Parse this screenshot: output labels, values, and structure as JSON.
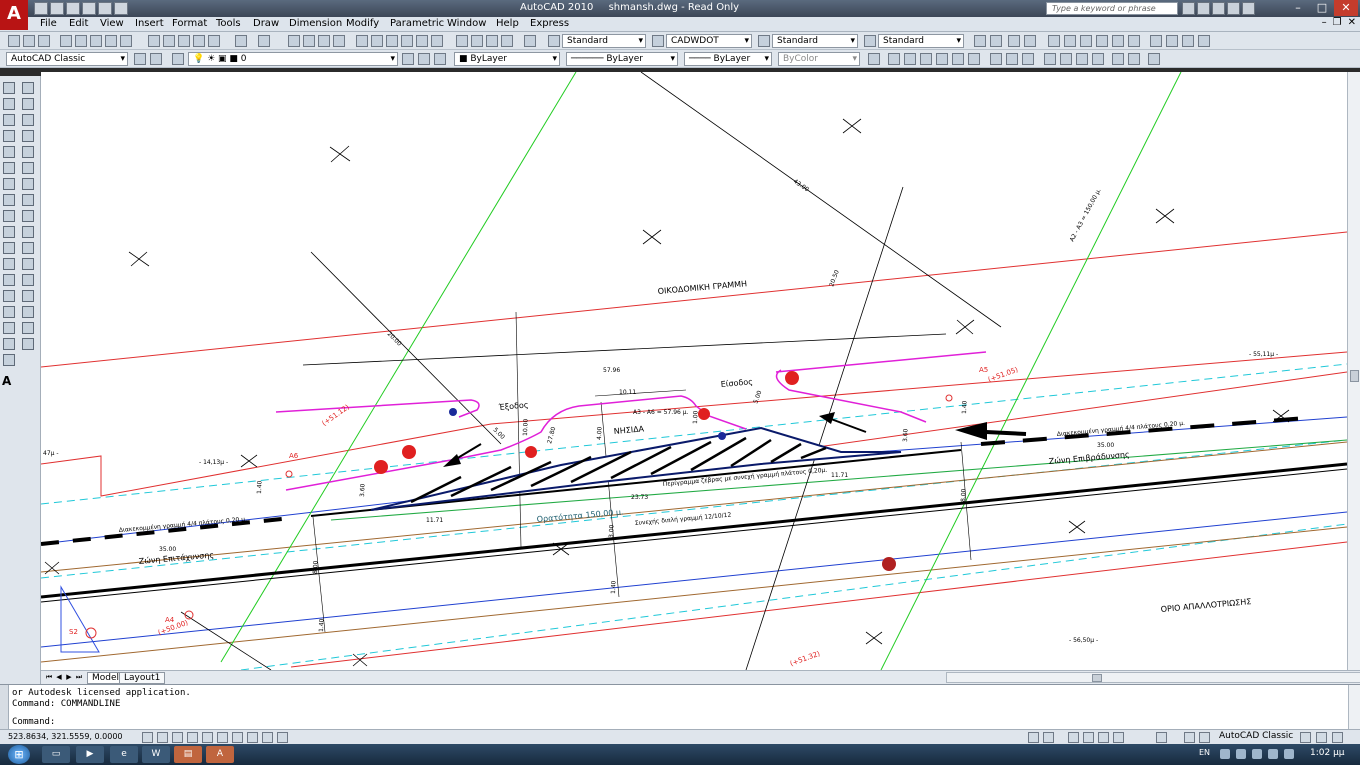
{
  "window": {
    "app_name": "AutoCAD 2010",
    "document_title": "shmansh.dwg - Read Only",
    "search_placeholder": "Type a keyword or phrase",
    "logo_letter": "A"
  },
  "menu": {
    "items": [
      "File",
      "Edit",
      "View",
      "Insert",
      "Format",
      "Tools",
      "Draw",
      "Dimension",
      "Modify",
      "Parametric",
      "Window",
      "Help",
      "Express"
    ]
  },
  "toolbars": {
    "text_style": "Standard",
    "dim_style": "CADWDOT",
    "table_style": "Standard",
    "mleader_style": "Standard",
    "workspace": "AutoCAD Classic",
    "layer": "0",
    "color": "ByLayer",
    "linetype": "ByLayer",
    "lineweight": "ByLayer",
    "plotstyle": "ByColor"
  },
  "drawing": {
    "labels": {
      "building_line": "ΟΙΚΟΔΟΜΙΚΗ ΓΡΑΜΜΗ",
      "expropriation_limit": "ΟΡΙΟ ΑΠΑΛΛΟΤΡΙΩΣΗΣ",
      "island": "ΝΗΣΙΔΑ",
      "entrance": "Είσοδος",
      "exit": "Έξοδος",
      "decel_zone": "Ζώνη Επιβράδυνσης",
      "accel_zone": "Ζώνη Επιτάχυνσης",
      "visibility": "Ορατότητα 150,00 μ.",
      "dashed_line_right": "Διακεκομμένη γραμμή 4/4 πλάτους 0,20 μ.",
      "dashed_line_left": "Διακεκομμένη γραμμή 4/4 πλάτους 0,20 μ.",
      "border_line": "Περίγραμμα ζέβρας με συνεχή γραμμή πλάτους 0,20μ.",
      "continuous_line": "Συνεχής διπλή γραμμή 12/10/12",
      "a3a6": "Α3 - Α6 = 57.96 μ.",
      "a2a3": "Α2 - Α3 = 150,00 μ.",
      "a5": "Α5",
      "a5_level": "(+51.05)",
      "a6": "Α6",
      "a6_level": "(+51.12)",
      "a4": "Α4",
      "a4_level": "(+50.00)",
      "bottom_level": "(+51.32)",
      "level_right_top": "- 55,11μ -",
      "level_right_bottom": "- 56,50μ -",
      "level_left": "- 14,13μ -",
      "left_edge": "47μ -",
      "s2": "S2"
    },
    "dims": {
      "d5796": "57.96",
      "d3500_right": "35.00",
      "d3500_left": "35.00",
      "d1171_left": "11.71",
      "d1171_right": "11.71",
      "d2373": "23.73",
      "d1011": "10.11",
      "d4300": "43.00",
      "d2050": "20.50",
      "d2000": "20.00",
      "d500a": "5.00",
      "d500b": "5.00",
      "d10": "10.00",
      "d400": "4.00",
      "d360a": "3.60",
      "d360b": "3.60",
      "d140a": "1.40",
      "d140b": "1.40",
      "d140c": "1.40",
      "d140d": "1.40",
      "d800a": "8.00",
      "d800b": "8.00",
      "d300": "3.00",
      "d2780": "27.80",
      "d100": "1.00"
    }
  },
  "layout_tabs": [
    "Model",
    "Layout1"
  ],
  "command": {
    "line1": "or Autodesk licensed application.",
    "line2": "Command: COMMANDLINE",
    "prompt": "Command:"
  },
  "status": {
    "coords": "523.8634, 321.5559, 0.0000",
    "workspace": "AutoCAD Classic"
  },
  "taskbar": {
    "lang": "EN",
    "time": "1:02 μμ"
  }
}
